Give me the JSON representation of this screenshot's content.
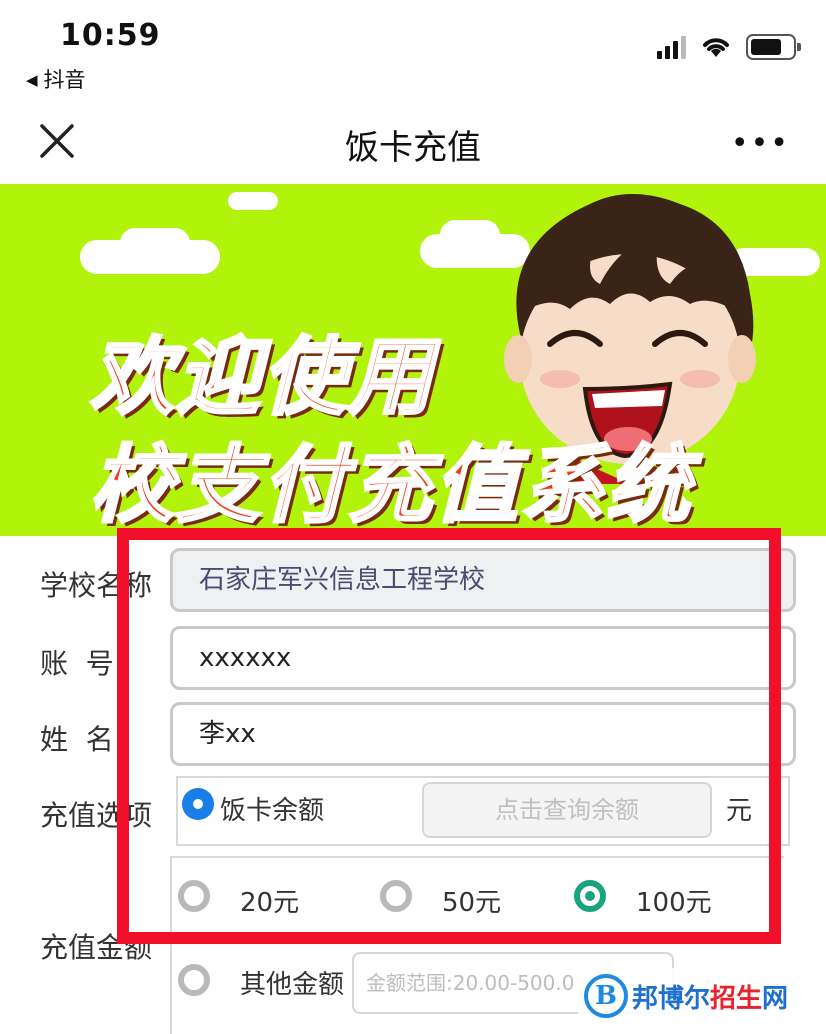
{
  "status_bar": {
    "time": "10:59",
    "back_app": "抖音"
  },
  "nav": {
    "title": "饭卡充值",
    "more": "•••"
  },
  "banner": {
    "line1": "欢迎使用",
    "line2": "校支付充值系统"
  },
  "form": {
    "school": {
      "label": "学校名称",
      "value": "石家庄军兴信息工程学校"
    },
    "account": {
      "label": "账  号",
      "value": "xxxxxx"
    },
    "name": {
      "label": "姓  名",
      "value": "李xx"
    },
    "option": {
      "label": "充值选项",
      "radio_label": "饭卡余额",
      "query_button": "点击查询余额",
      "unit": "元"
    },
    "amount": {
      "label": "充值金额",
      "choices": [
        {
          "label": "20元",
          "selected": false
        },
        {
          "label": "50元",
          "selected": false
        },
        {
          "label": "100元",
          "selected": true
        }
      ],
      "other_label": "其他金额",
      "other_placeholder": "金额范围:20.00-500.0"
    }
  },
  "watermark": {
    "logo": "B",
    "text_a": "邦博尔",
    "text_b": "招生",
    "text_c": "网"
  },
  "colors": {
    "banner_green": "#b1f30a",
    "highlight_red": "#f0102a",
    "radio_blue": "#1a7ee8",
    "radio_teal": "#1aa37f"
  }
}
